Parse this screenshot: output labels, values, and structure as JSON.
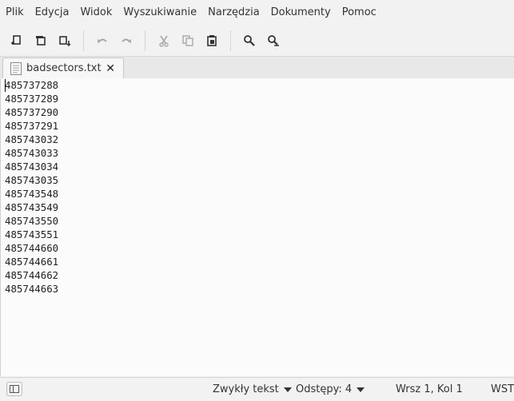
{
  "menu": [
    "Plik",
    "Edycja",
    "Widok",
    "Wyszukiwanie",
    "Narzędzia",
    "Dokumenty",
    "Pomoc"
  ],
  "toolbar": {
    "icons": [
      "new-document-icon",
      "open-document-icon",
      "save-document-icon",
      "undo-icon",
      "redo-icon",
      "cut-icon",
      "copy-icon",
      "paste-icon",
      "search-icon",
      "replace-icon"
    ]
  },
  "tab": {
    "label": "badsectors.txt",
    "close": "✕"
  },
  "editor": {
    "lines": [
      "485737288",
      "485737289",
      "485737290",
      "485737291",
      "485743032",
      "485743033",
      "485743034",
      "485743035",
      "485743548",
      "485743549",
      "485743550",
      "485743551",
      "485744660",
      "485744661",
      "485744662",
      "485744663"
    ]
  },
  "status": {
    "syntax": "Zwykły tekst",
    "indent": "Odstępy: 4",
    "position": "Wrsz 1, Kol 1",
    "mode": "WST"
  }
}
